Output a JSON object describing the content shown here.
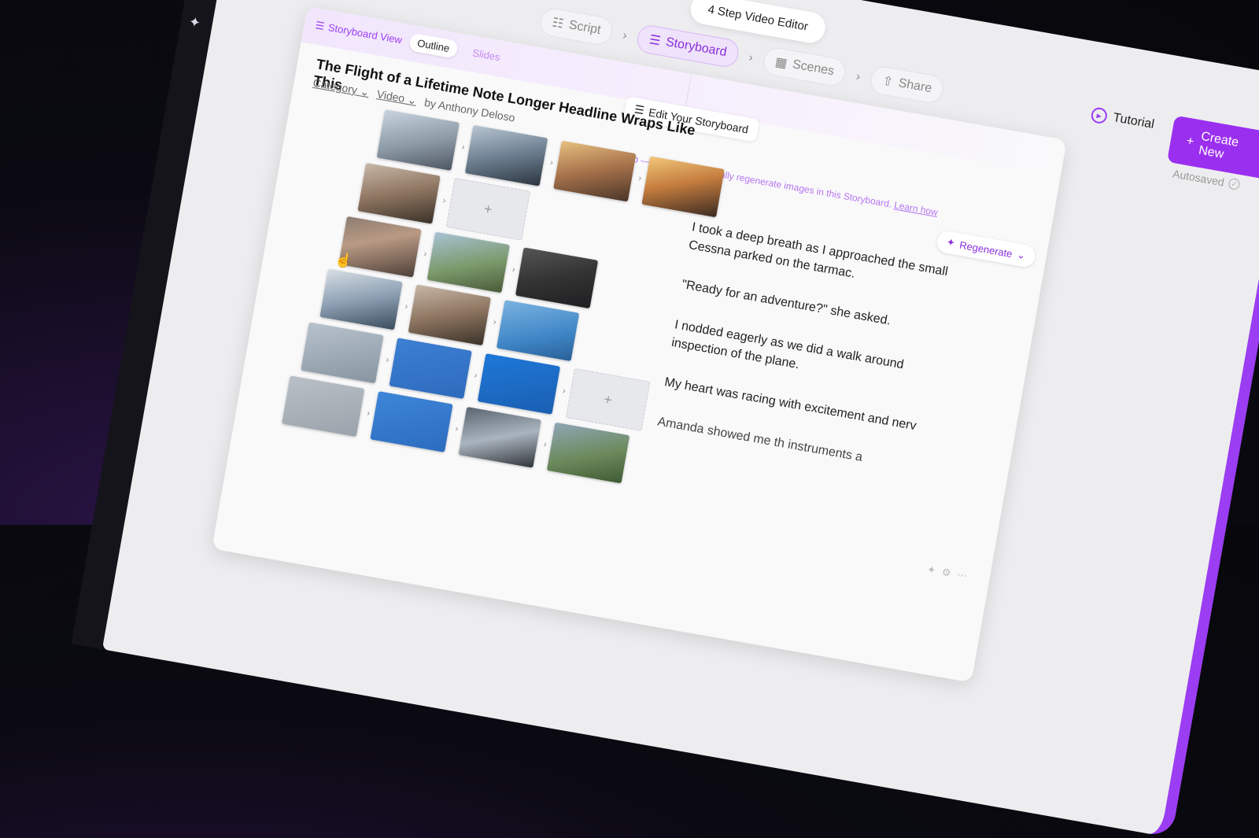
{
  "editor": {
    "title": "4 Step Video Editor"
  },
  "steps": [
    {
      "label": "Script",
      "icon": "script-icon"
    },
    {
      "label": "Storyboard",
      "icon": "storyboard-icon",
      "active": true
    },
    {
      "label": "Scenes",
      "icon": "scenes-icon"
    },
    {
      "label": "Share",
      "icon": "share-icon"
    }
  ],
  "tutorial": {
    "label": "Tutorial"
  },
  "create": {
    "label": "Create New"
  },
  "autosaved": {
    "label": "Autosaved"
  },
  "view": {
    "label": "Storyboard View",
    "options": [
      "Outline",
      "Slides"
    ],
    "selected": "Outline"
  },
  "edit_storyboard": {
    "label": "Edit Your Storyboard"
  },
  "headline": "The Flight of a Lifetime Note Longer Headline Wraps Like This",
  "meta": {
    "category": "Category",
    "type": "Video",
    "byline": "by Anthony Deloso"
  },
  "protip": {
    "prefix": "Pro Tip — You can individually regenerate images in this Storyboard.",
    "link": "Learn how"
  },
  "regenerate": {
    "label": "Regenerate"
  },
  "story": [
    "I took a deep breath as I approached the small Cessna parked on the tarmac.",
    "\"Ready for an adventure?\" she asked.",
    "I nodded eagerly as we did a walk around inspection of the plane.",
    "My heart was racing with excitement and nerv",
    "Amanda showed me th instruments a"
  ],
  "colors": {
    "accent": "#9b2ff0",
    "accent_light": "#efe2fb",
    "background": "#ededef"
  }
}
